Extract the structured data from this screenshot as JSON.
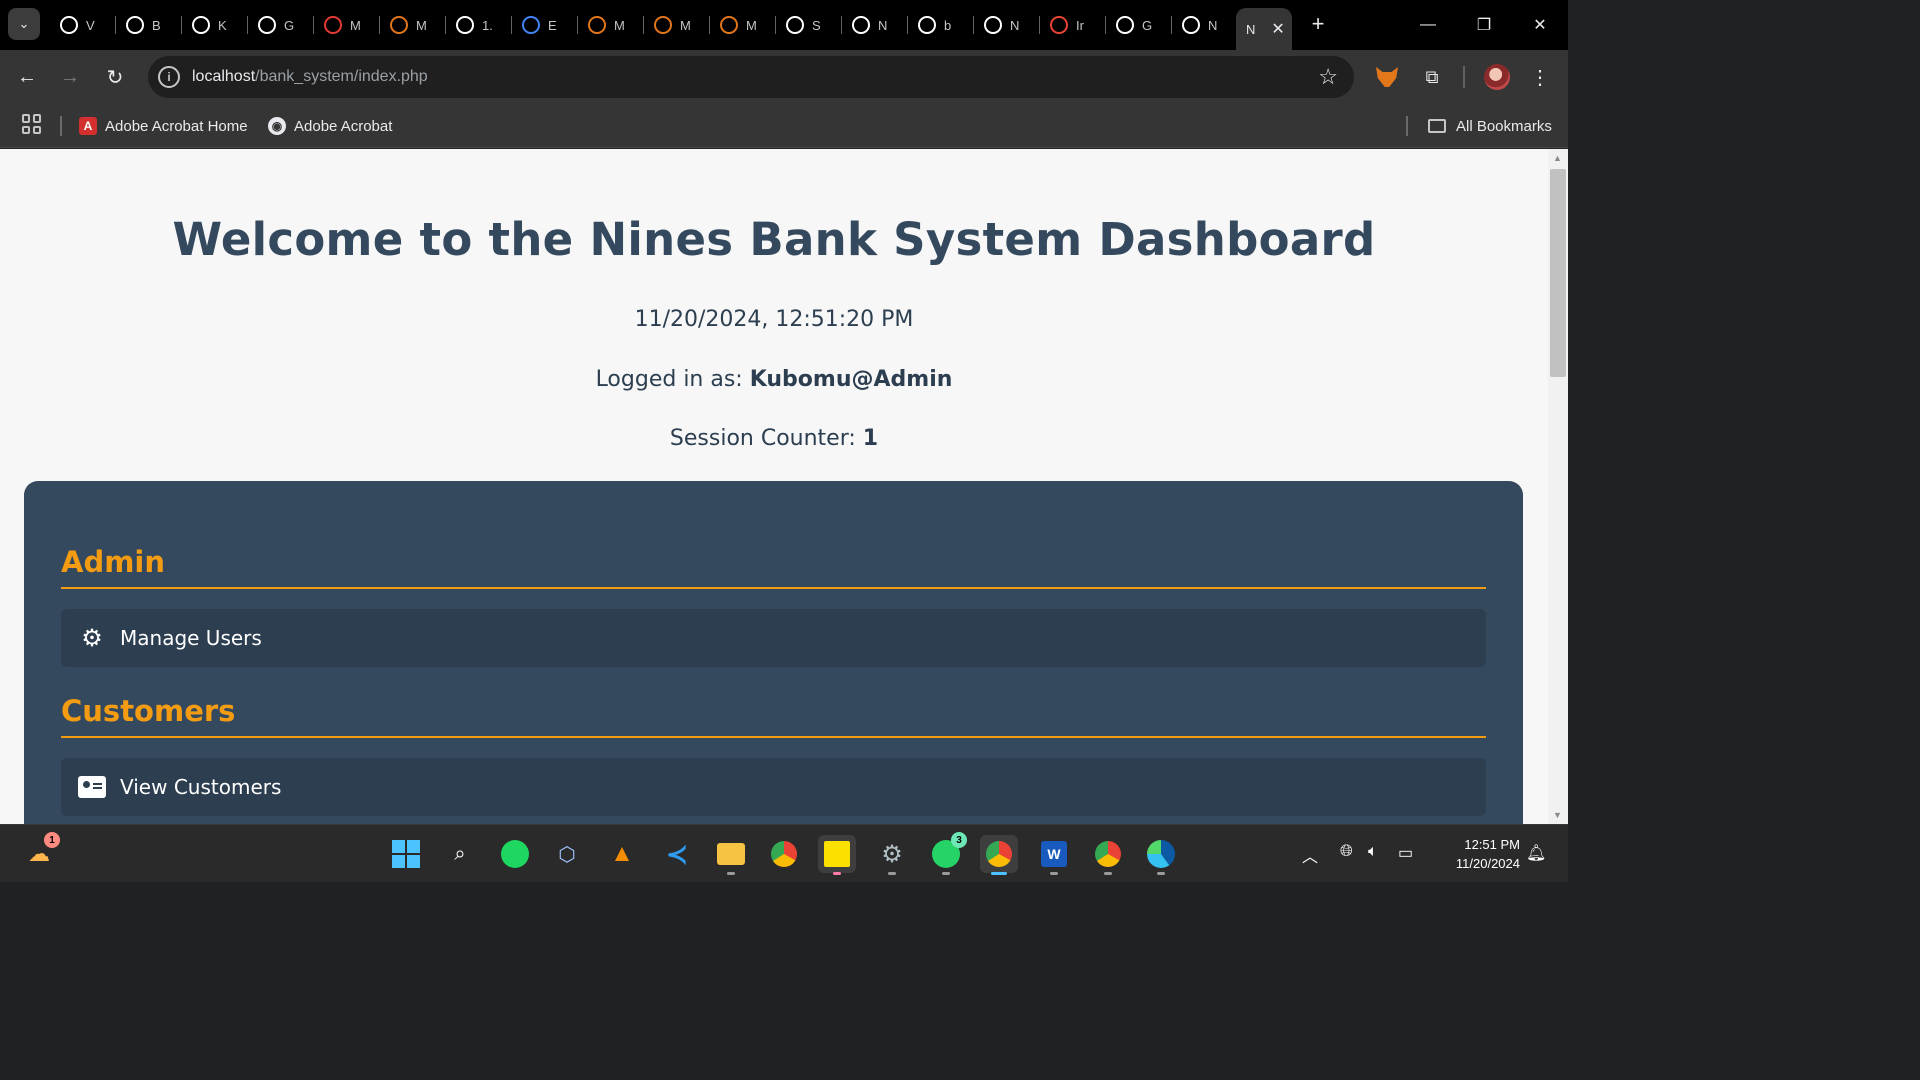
{
  "tabs": [
    {
      "letter": "V",
      "icon": "chrome-icon",
      "color": "#ffffff"
    },
    {
      "letter": "B",
      "icon": "openai-icon",
      "color": "#ffffff"
    },
    {
      "letter": "K",
      "icon": "github-icon",
      "color": "#ffffff"
    },
    {
      "letter": "G",
      "icon": "site-icon",
      "color": "#ffffff"
    },
    {
      "letter": "M",
      "icon": "site-icon",
      "color": "#e53935"
    },
    {
      "letter": "M",
      "icon": "metamask-icon",
      "color": "#e2761b"
    },
    {
      "letter": "1.",
      "icon": "globe-icon",
      "color": "#ffffff"
    },
    {
      "letter": "E",
      "icon": "google-cloud-icon",
      "color": "#4285f4"
    },
    {
      "letter": "M",
      "icon": "metamask-icon",
      "color": "#e2761b"
    },
    {
      "letter": "M",
      "icon": "metamask-icon",
      "color": "#e2761b"
    },
    {
      "letter": "M",
      "icon": "metamask-icon",
      "color": "#e2761b"
    },
    {
      "letter": "S",
      "icon": "chart-icon",
      "color": "#ffffff"
    },
    {
      "letter": "N",
      "icon": "github-icon",
      "color": "#ffffff"
    },
    {
      "letter": "b",
      "icon": "google-icon",
      "color": "#ffffff"
    },
    {
      "letter": "N",
      "icon": "chrome-icon",
      "color": "#ffffff"
    },
    {
      "letter": "Ir",
      "icon": "gmail-icon",
      "color": "#ea4335"
    },
    {
      "letter": "G",
      "icon": "google-lens-icon",
      "color": "#ffffff"
    },
    {
      "letter": "N",
      "icon": "chrome-icon",
      "color": "#ffffff"
    }
  ],
  "active_tab": {
    "letter": "N",
    "close": "✕"
  },
  "window": {
    "minimize": "—",
    "restore": "❐",
    "close": "✕",
    "new_tab": "+",
    "tab_search": "⌄"
  },
  "toolbar": {
    "back": "←",
    "forward": "→",
    "reload": "↻",
    "info": "i",
    "url_host": "localhost",
    "url_path": "/bank_system/index.php",
    "star": "☆",
    "extensions": "⧉",
    "menu": "⋮"
  },
  "bookmarks": {
    "items": [
      {
        "label": "Adobe Acrobat Home",
        "icon": "A"
      },
      {
        "label": "Adobe Acrobat",
        "icon": "◉"
      }
    ],
    "all_bookmarks": "All Bookmarks"
  },
  "page": {
    "title": "Welcome to the Nines Bank System Dashboard",
    "datetime": "11/20/2024, 12:51:20 PM",
    "logged_in_label": "Logged in as:",
    "logged_in_user": "Kubomu@Admin",
    "session_label": "Session Counter:",
    "session_value": "1",
    "sections": [
      {
        "heading": "Admin",
        "items": [
          {
            "label": "Manage Users",
            "icon": "gears-icon"
          }
        ]
      },
      {
        "heading": "Customers",
        "items": [
          {
            "label": "View Customers",
            "icon": "id-card-icon"
          }
        ]
      }
    ]
  },
  "taskbar": {
    "weather_badge": "1",
    "whatsapp_badge": "3",
    "clock_time": "12:51 PM",
    "clock_date": "11/20/2024"
  },
  "colors": {
    "accent": "#f39c12",
    "panel": "#34495e",
    "item": "#2c3e50",
    "heading": "#34495e"
  }
}
